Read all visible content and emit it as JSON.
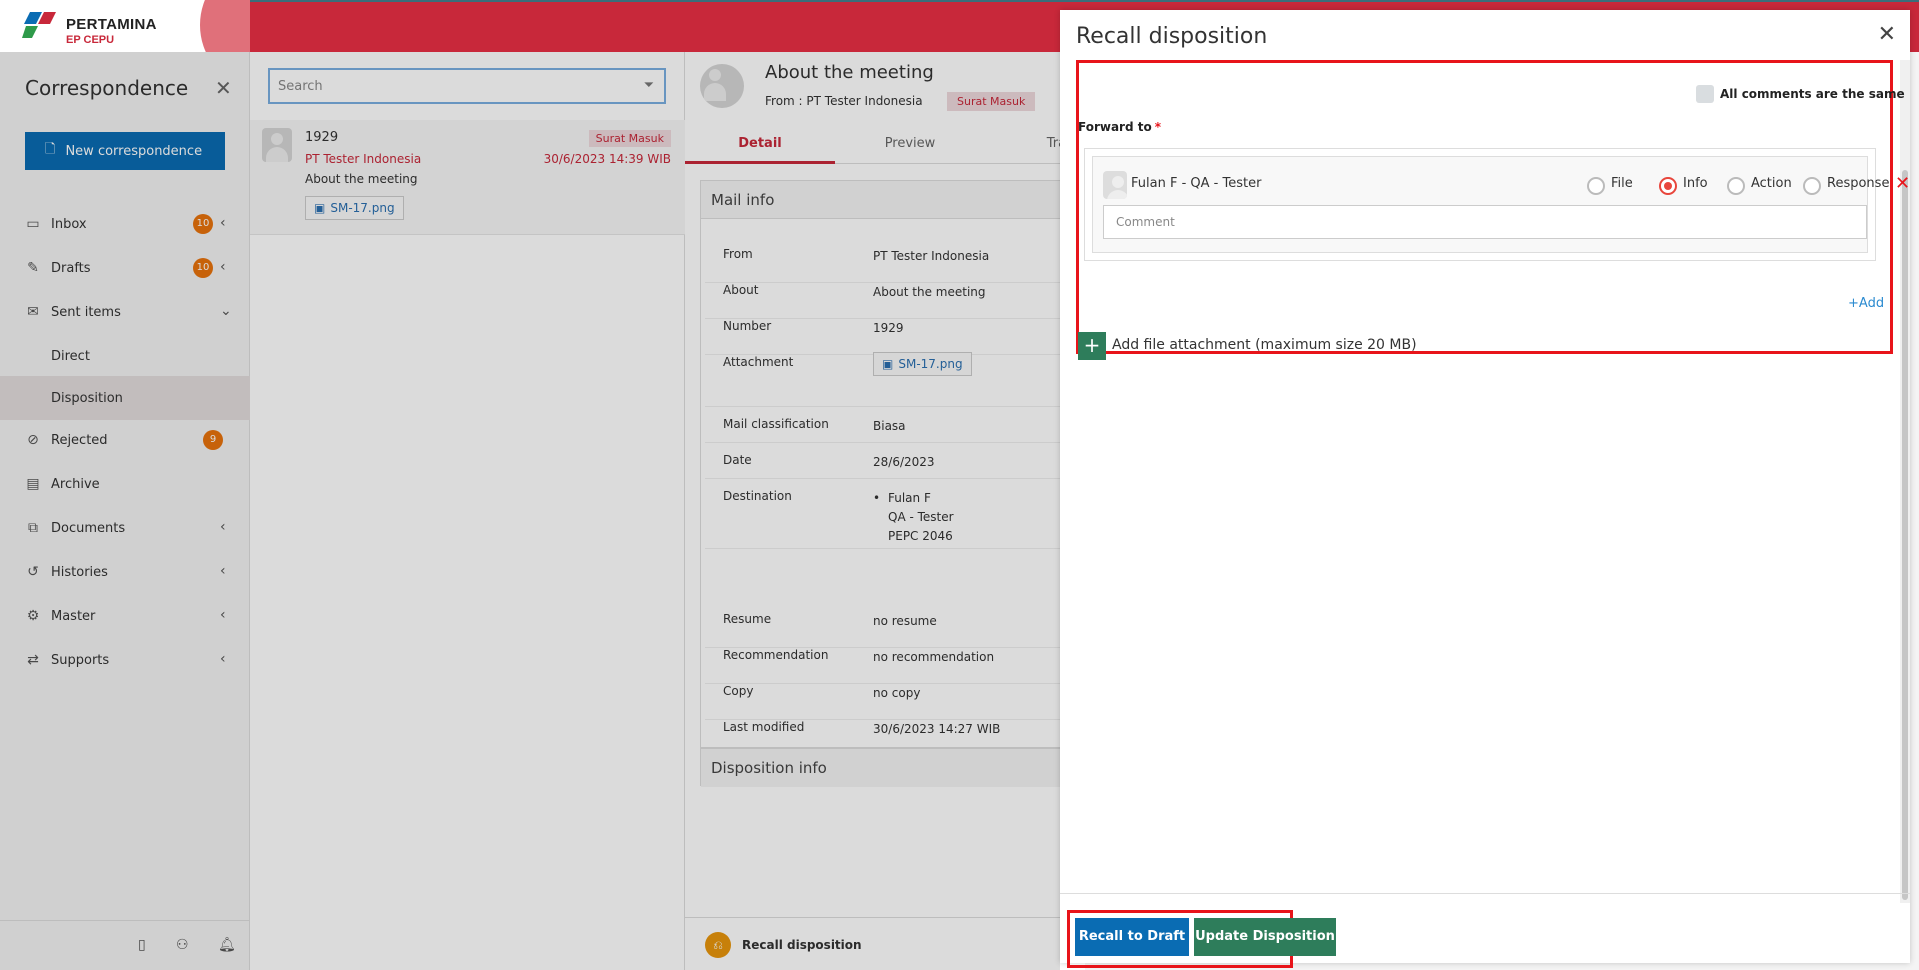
{
  "brand": {
    "name": "PERTAMINA",
    "sub": "EP CEPU"
  },
  "sidebar": {
    "title": "Correspondence",
    "new_button": "New correspondence",
    "items": [
      {
        "label": "Inbox",
        "badge": "10"
      },
      {
        "label": "Drafts",
        "badge": "10"
      },
      {
        "label": "Sent items"
      },
      {
        "label": "Direct"
      },
      {
        "label": "Disposition"
      },
      {
        "label": "Rejected",
        "badge": "9"
      },
      {
        "label": "Archive"
      },
      {
        "label": "Documents"
      },
      {
        "label": "Histories"
      },
      {
        "label": "Master"
      },
      {
        "label": "Supports"
      }
    ]
  },
  "list": {
    "search_placeholder": "Search",
    "item": {
      "number": "1929",
      "from": "PT Tester Indonesia",
      "about": "About the meeting",
      "badge": "Surat Masuk",
      "date": "30/6/2023 14:39 WIB",
      "attachment": "SM-17.png"
    }
  },
  "detail": {
    "title": "About the meeting",
    "from": "From : PT Tester Indonesia",
    "badge": "Surat Masuk",
    "tabs": [
      "Detail",
      "Preview",
      "Trac"
    ],
    "mail_info_title": "Mail info",
    "rows": {
      "from": {
        "k": "From",
        "v": "PT Tester Indonesia"
      },
      "about": {
        "k": "About",
        "v": "About the meeting"
      },
      "number": {
        "k": "Number",
        "v": "1929"
      },
      "attachment": {
        "k": "Attachment",
        "v": "SM-17.png"
      },
      "classification": {
        "k": "Mail classification",
        "v": "Biasa"
      },
      "date": {
        "k": "Date",
        "v": "28/6/2023"
      },
      "destination": {
        "k": "Destination",
        "v1": "Fulan F",
        "v2": "QA - Tester",
        "v3": "PEPC 2046"
      },
      "resume": {
        "k": "Resume",
        "v": "no resume"
      },
      "recommendation": {
        "k": "Recommendation",
        "v": "no recommendation"
      },
      "copy": {
        "k": "Copy",
        "v": "no copy"
      },
      "modified": {
        "k": "Last modified",
        "v": "30/6/2023 14:27 WIB"
      }
    },
    "disposition_info_title": "Disposition info",
    "recall_label": "Recall disposition"
  },
  "modal": {
    "title": "Recall disposition",
    "all_same_label": "All comments are the same",
    "forward_label": "Forward to",
    "required_mark": "*",
    "recipient": "Fulan F - QA - Tester",
    "options": [
      "File",
      "Info",
      "Action",
      "Response"
    ],
    "selected_option": "Info",
    "comment_placeholder": "Comment",
    "add_label": "Add",
    "attachment_label": "Add file attachment (maximum size 20 MB)",
    "recall_button": "Recall to Draft",
    "update_button": "Update Disposition"
  },
  "colors": {
    "brand_red": "#c8283a",
    "primary_blue": "#0a6cb3",
    "green": "#2e7d5b",
    "badge_orange": "#e8730c",
    "highlight_red": "#e8141a"
  }
}
